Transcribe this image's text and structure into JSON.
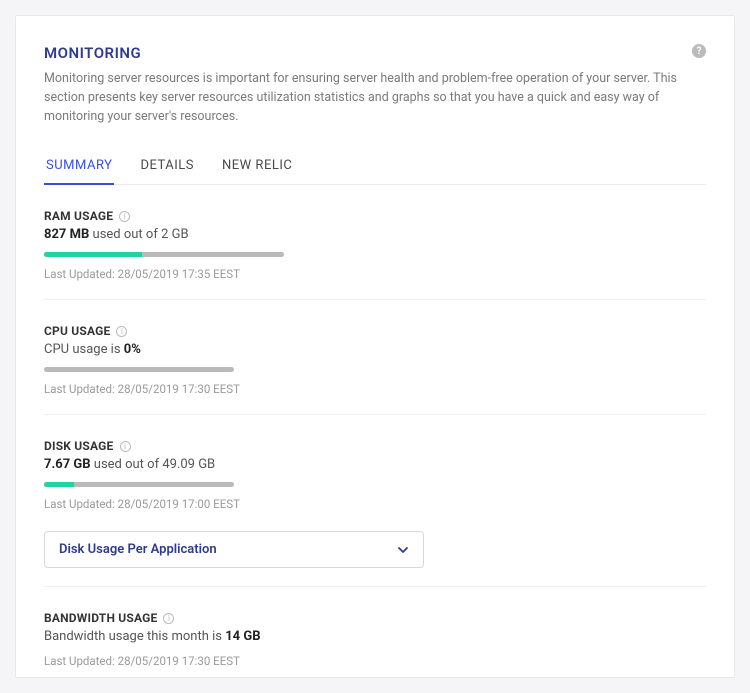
{
  "header": {
    "title": "MONITORING",
    "description": "Monitoring server resources is important for ensuring server health and problem-free operation of your server. This section presents key server resources utilization statistics and graphs so that you have a quick and easy way of monitoring your server's resources.",
    "help_icon": "?"
  },
  "tabs": [
    {
      "label": "SUMMARY",
      "active": true
    },
    {
      "label": "DETAILS",
      "active": false
    },
    {
      "label": "NEW RELIC",
      "active": false
    }
  ],
  "ram": {
    "title": "RAM USAGE",
    "value": "827 MB",
    "suffix": " used out of 2 GB",
    "percent": 41,
    "last_updated_label": "Last Updated: ",
    "last_updated": "28/05/2019 17:35 EEST"
  },
  "cpu": {
    "title": "CPU USAGE",
    "prefix": "CPU usage is ",
    "value": "0%",
    "percent": 0,
    "last_updated_label": "Last Updated: ",
    "last_updated": "28/05/2019 17:30 EEST"
  },
  "disk": {
    "title": "DISK USAGE",
    "value": "7.67 GB",
    "suffix": " used out of 49.09 GB",
    "percent": 16,
    "last_updated_label": "Last Updated: ",
    "last_updated": "28/05/2019 17:00 EEST",
    "dropdown_label": "Disk Usage Per Application"
  },
  "bandwidth": {
    "title": "BANDWIDTH USAGE",
    "prefix": "Bandwidth usage this month is ",
    "value": "14 GB",
    "last_updated_label": "Last Updated: ",
    "last_updated": "28/05/2019 17:30 EEST"
  },
  "colors": {
    "accent": "#2f3b8f",
    "progress_fill": "#1fd3a2",
    "progress_bg": "#bababa"
  }
}
